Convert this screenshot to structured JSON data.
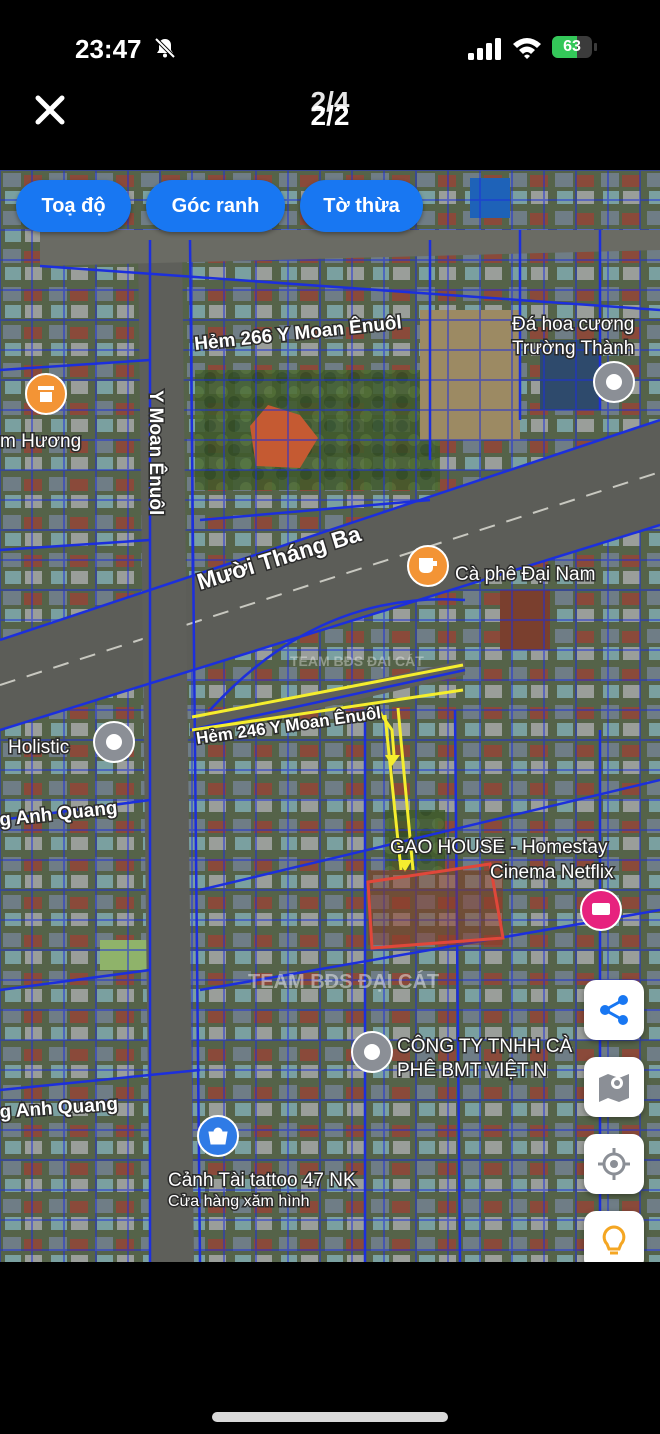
{
  "status": {
    "time": "23:47",
    "battery": "63",
    "battery_level": 0.63
  },
  "topbar": {
    "counter": "2/2",
    "counter_ghost": "2/4"
  },
  "chips": [
    "Toạ độ",
    "Góc ranh",
    "Tờ thừa"
  ],
  "map": {
    "streets": {
      "hem266": "Hẻm 266 Y Moan Ênuôl",
      "ymoan": "Y Moan Ênuôl",
      "muoithangba": "Mười Tháng Ba",
      "hem246": "Hẻm 246 Y Moan Ênuôl",
      "anhquang1": "g Anh Quang",
      "anhquang2": "g Anh Quang"
    },
    "places": {
      "dahoa_line1": "Đá hoa cương",
      "dahoa_line2": "Trường Thành",
      "huong": "m Hương",
      "caphe": "Cà phê Đại Nam",
      "holistic": "Holistic",
      "gao_line1": "GAO HOUSE - Homestay",
      "gao_line2": "Cinema Netflix",
      "congty_line1": "CÔNG TY TNHH CÀ",
      "congty_line2": "PHÊ BMT VIỆT N",
      "tattoo_name": "Cảnh Tài tattoo 47 NK",
      "tattoo_sub": "Cửa hàng xăm hình"
    },
    "watermarks": [
      "TEAM BĐS ĐẠI CÁT",
      "TEAM BĐS ĐẠI CÁT"
    ],
    "colors": {
      "parcel": "#1c2fdc",
      "road": "#5c5d58",
      "route": "#f5ee2e",
      "plot": "#e0473a",
      "accent": "#1877f2",
      "pin_orange": "#f39435",
      "pin_pink": "#e7227e"
    }
  },
  "fabs": [
    "share-icon",
    "map-icon",
    "locate-icon",
    "lightbulb-icon"
  ]
}
